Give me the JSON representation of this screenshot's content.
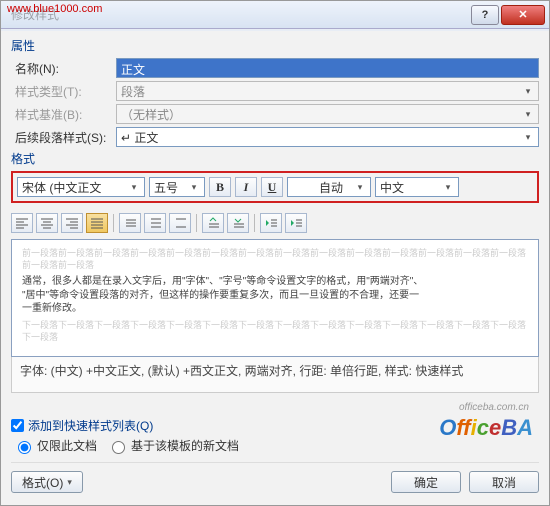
{
  "url_overlay": "www.blue1000.com",
  "titlebar": {
    "title": "修改样式"
  },
  "sections": {
    "properties": "属性",
    "format": "格式"
  },
  "form": {
    "name_label": "名称(N):",
    "name_value": "正文",
    "type_label": "样式类型(T):",
    "type_value": "段落",
    "base_label": "样式基准(B):",
    "base_value": "（无样式）",
    "next_label": "后续段落样式(S):",
    "next_value": "↵ 正文"
  },
  "format_bar": {
    "font": "宋体 (中文正文",
    "size": "五号",
    "bold": "B",
    "italic": "I",
    "underline": "U",
    "color": "自动",
    "lang": "中文"
  },
  "preview": {
    "ghost_before": "前一段落前一段落前一段落前一段落前一段落前一段落前一段落前一段落前一段落前一段落前一段落前一段落前一段落前一段落前一段落前一段落",
    "line1": "通常，很多人都是在录入文字后，用\"字体\"、\"字号\"等命令设置文字的格式，用\"两端对齐\"、",
    "line2": "\"居中\"等命令设置段落的对齐，但这样的操作要重复多次，而且一旦设置的不合理，还要一",
    "line3": "一重新修改。",
    "ghost_after": "下一段落下一段落下一段落下一段落下一段落下一段落下一段落下一段落下一段落下一段落下一段落下一段落下一段落下一段落下一段落"
  },
  "description": "字体: (中文) +中文正文, (默认) +西文正文, 两端对齐, 行距: 单倍行距, 样式: 快速样式",
  "bottom": {
    "add_quick": "添加到快速样式列表(Q)",
    "only_doc": "仅限此文档",
    "based_template": "基于该模板的新文档",
    "format_btn": "格式(O)",
    "ok": "确定",
    "cancel": "取消"
  },
  "watermark": {
    "url": "officeba.com.cn"
  }
}
